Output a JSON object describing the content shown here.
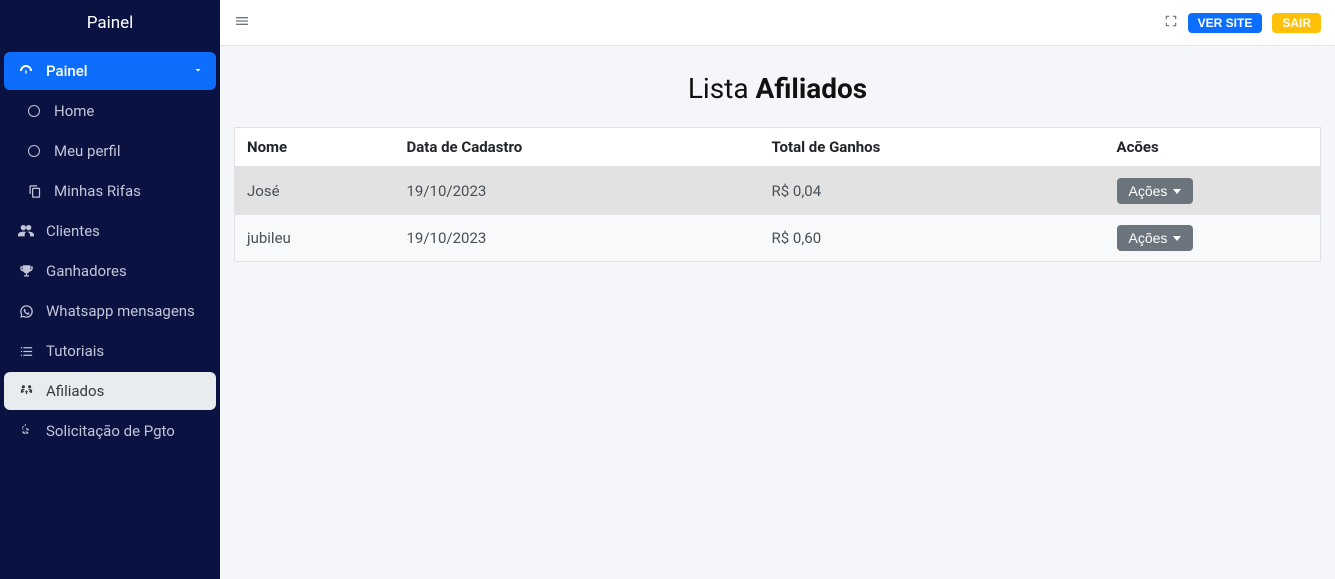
{
  "sidebar": {
    "title": "Painel",
    "primary_label": "Painel",
    "items": [
      {
        "label": "Home"
      },
      {
        "label": "Meu perfil"
      },
      {
        "label": "Minhas Rifas"
      },
      {
        "label": "Clientes"
      },
      {
        "label": "Ganhadores"
      },
      {
        "label": "Whatsapp mensagens"
      },
      {
        "label": "Tutoriais"
      },
      {
        "label": "Afiliados"
      },
      {
        "label": "Solicitação de Pgto"
      }
    ]
  },
  "topbar": {
    "ver_site": "VER SITE",
    "sair": "SAIR"
  },
  "page": {
    "title_prefix": "Lista ",
    "title_bold": "Afiliados"
  },
  "table": {
    "headers": {
      "nome": "Nome",
      "data": "Data de Cadastro",
      "total": "Total de Ganhos",
      "acoes": "Acões"
    },
    "action_label": "Ações",
    "rows": [
      {
        "nome": "José",
        "data": "19/10/2023",
        "total": "R$ 0,04"
      },
      {
        "nome": "jubileu",
        "data": "19/10/2023",
        "total": "R$ 0,60"
      }
    ]
  }
}
